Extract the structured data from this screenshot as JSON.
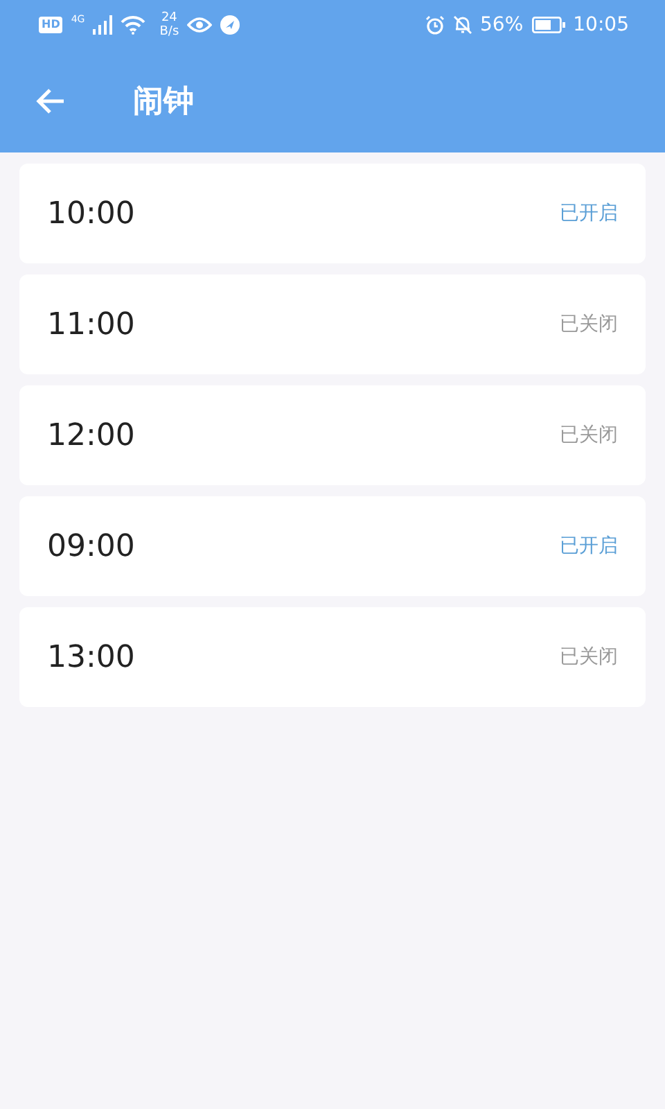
{
  "status_bar": {
    "hd": "HD",
    "network": "4G",
    "speed_value": "24",
    "speed_unit": "B/s",
    "battery_percent": "56%",
    "time": "10:05"
  },
  "app_bar": {
    "title": "闹钟"
  },
  "alarms": [
    {
      "time": "10:00",
      "status": "已开启",
      "on": true
    },
    {
      "time": "11:00",
      "status": "已关闭",
      "on": false
    },
    {
      "time": "12:00",
      "status": "已关闭",
      "on": false
    },
    {
      "time": "09:00",
      "status": "已开启",
      "on": true
    },
    {
      "time": "13:00",
      "status": "已关闭",
      "on": false
    }
  ]
}
